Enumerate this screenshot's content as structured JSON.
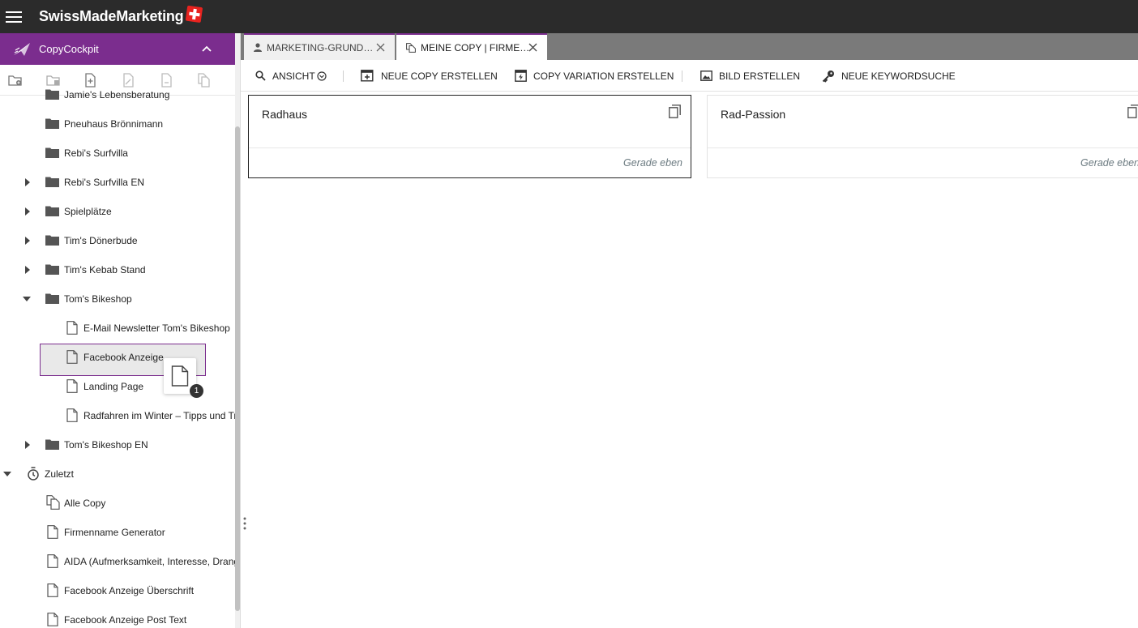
{
  "app": {
    "brand": "SwissMadeMarketing",
    "accent_color": "#7b2d8e",
    "topbar_color": "#2b2b2b"
  },
  "sidebar": {
    "title": "CopyCockpit",
    "toolbar_icons": [
      "new-folder-icon",
      "delete-folder-icon",
      "new-document-icon",
      "rename-document-icon",
      "delete-document-icon",
      "duplicate-document-icon"
    ],
    "tree": [
      {
        "label": "Jamie's Lebensberatung",
        "type": "folder",
        "caret": "none"
      },
      {
        "label": "Pneuhaus Brönnimann",
        "type": "folder",
        "caret": "none"
      },
      {
        "label": "Rebi's Surfvilla",
        "type": "folder",
        "caret": "none"
      },
      {
        "label": "Rebi's Surfvilla EN",
        "type": "folder",
        "caret": "right"
      },
      {
        "label": "Spielplätze",
        "type": "folder",
        "caret": "right"
      },
      {
        "label": "Tim's Dönerbude",
        "type": "folder",
        "caret": "right"
      },
      {
        "label": "Tim's Kebab Stand",
        "type": "folder",
        "caret": "right"
      },
      {
        "label": "Tom's Bikeshop",
        "type": "folder",
        "caret": "down"
      },
      {
        "label": "E-Mail Newsletter Tom's Bikeshop",
        "type": "document",
        "caret": "none"
      },
      {
        "label": "Facebook Anzeige",
        "type": "document",
        "caret": "none"
      },
      {
        "label": "Landing Page",
        "type": "document",
        "caret": "none"
      },
      {
        "label": "Radfahren im Winter – Tipps und Tricks",
        "type": "document",
        "caret": "none"
      },
      {
        "label": "Tom's Bikeshop EN",
        "type": "folder",
        "caret": "right"
      },
      {
        "label": "Zuletzt",
        "type": "recent",
        "caret": "down"
      },
      {
        "label": "Alle Copy",
        "type": "multi-document",
        "caret": "none"
      },
      {
        "label": "Firmenname Generator",
        "type": "document",
        "caret": "none"
      },
      {
        "label": "AIDA (Aufmerksamkeit, Interesse, Drang, Aktion)",
        "type": "document",
        "caret": "none"
      },
      {
        "label": "Facebook Anzeige Überschrift",
        "type": "document",
        "caret": "none"
      },
      {
        "label": "Facebook Anzeige Post Text",
        "type": "document",
        "caret": "none"
      }
    ],
    "drag_badge": "1"
  },
  "tabs": [
    {
      "label": "MARKETING-GRUND…",
      "icon": "person-icon",
      "active": false
    },
    {
      "label": "MEINE COPY | FIRME…",
      "icon": "documents-icon",
      "active": true
    }
  ],
  "actions": [
    {
      "label": "ANSICHT",
      "icon": "search-icon"
    },
    {
      "label": "NEUE COPY ERSTELLEN",
      "icon": "new-copy-icon"
    },
    {
      "label": "COPY VARIATION ERSTELLEN",
      "icon": "lightning-icon"
    },
    {
      "label": "BILD ERSTELLEN",
      "icon": "image-icon"
    },
    {
      "label": "NEUE KEYWORDSUCHE",
      "icon": "key-icon"
    }
  ],
  "cards": [
    {
      "title": "Radhaus",
      "time": "Gerade eben",
      "selected": true
    },
    {
      "title": "Rad-Passion",
      "time": "Gerade eben",
      "selected": false
    }
  ]
}
